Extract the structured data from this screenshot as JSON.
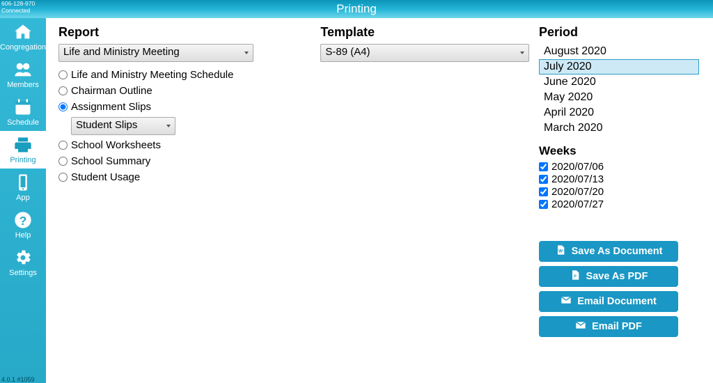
{
  "title": "Printing",
  "status_id": "606-128-970",
  "status_state": "Connected",
  "version": "4.0.1 #1059",
  "sidebar": {
    "items": [
      {
        "label": "Congregation"
      },
      {
        "label": "Members"
      },
      {
        "label": "Schedule"
      },
      {
        "label": "Printing"
      },
      {
        "label": "App"
      },
      {
        "label": "Help"
      },
      {
        "label": "Settings"
      }
    ],
    "active_index": 3
  },
  "report": {
    "heading": "Report",
    "dropdown_value": "Life and Ministry Meeting",
    "options": [
      {
        "label": "Life and Ministry Meeting Schedule"
      },
      {
        "label": "Chairman Outline"
      },
      {
        "label": "Assignment Slips"
      },
      {
        "label": "School Worksheets"
      },
      {
        "label": "School Summary"
      },
      {
        "label": "Student Usage"
      }
    ],
    "selected_option_index": 2,
    "sub_dropdown_value": "Student Slips"
  },
  "template": {
    "heading": "Template",
    "dropdown_value": "S-89 (A4)"
  },
  "period": {
    "heading": "Period",
    "items": [
      "August 2020",
      "July 2020",
      "June 2020",
      "May 2020",
      "April 2020",
      "March 2020"
    ],
    "selected_index": 1
  },
  "weeks": {
    "heading": "Weeks",
    "items": [
      {
        "label": "2020/07/06",
        "checked": true
      },
      {
        "label": "2020/07/13",
        "checked": true
      },
      {
        "label": "2020/07/20",
        "checked": true
      },
      {
        "label": "2020/07/27",
        "checked": true
      }
    ]
  },
  "buttons": {
    "save_doc": "Save As Document",
    "save_pdf": "Save As PDF",
    "email_doc": "Email Document",
    "email_pdf": "Email PDF"
  }
}
